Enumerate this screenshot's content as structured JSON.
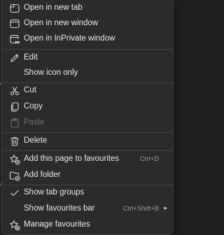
{
  "menu": {
    "items": [
      {
        "label": "Open in new tab",
        "icon": "new-tab-icon"
      },
      {
        "label": "Open in new window",
        "icon": "new-window-icon"
      },
      {
        "label": "Open in InPrivate window",
        "icon": "inprivate-window-icon"
      },
      {
        "label": "Edit",
        "icon": "pencil-icon"
      },
      {
        "label": "Show icon only",
        "icon": ""
      },
      {
        "label": "Cut",
        "icon": "scissors-icon"
      },
      {
        "label": "Copy",
        "icon": "copy-icon"
      },
      {
        "label": "Paste",
        "icon": "paste-icon",
        "disabled": true
      },
      {
        "label": "Delete",
        "icon": "trash-icon"
      },
      {
        "label": "Add this page to favourites",
        "icon": "star-add-icon",
        "shortcut": "Ctrl+D"
      },
      {
        "label": "Add folder",
        "icon": "folder-add-icon"
      },
      {
        "label": "Show tab groups",
        "icon": "checkmark-icon"
      },
      {
        "label": "Show favourites bar",
        "icon": "",
        "shortcut": "Ctrl+Shift+B"
      },
      {
        "label": "Manage favourites",
        "icon": "star-settings-icon"
      }
    ]
  },
  "colors": {
    "menu_bg": "#2b2b2b",
    "text": "#e8e8e8",
    "disabled_text": "#6e6e6e",
    "shortcut_text": "#9a9a9a",
    "separator": "#424242"
  }
}
